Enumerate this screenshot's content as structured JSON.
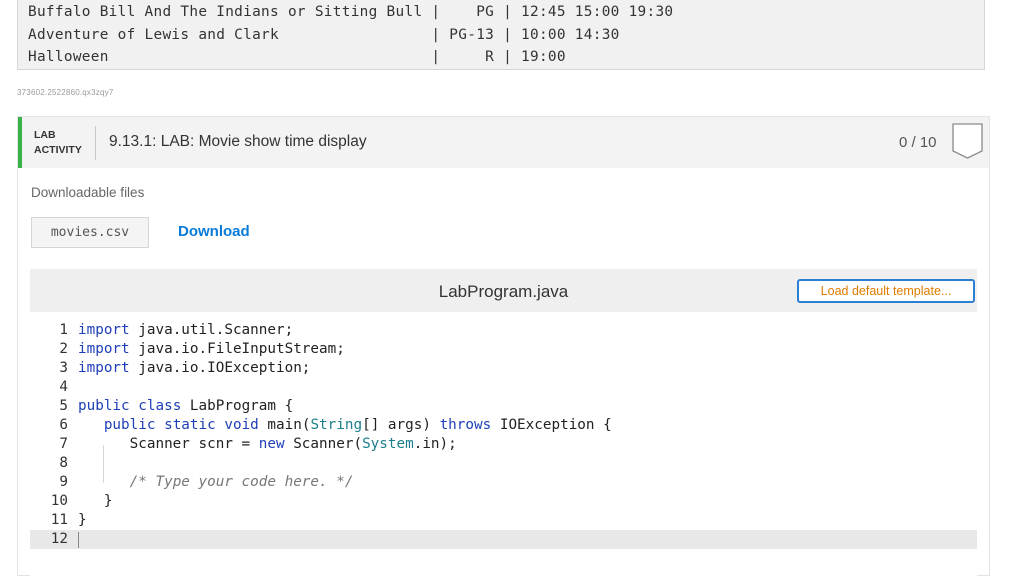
{
  "sample_output": {
    "lines": [
      "Buffalo Bill And The Indians or Sitting Bull |    PG | 12:45 15:00 19:30",
      "Adventure of Lewis and Clark                 | PG-13 | 10:00 14:30",
      "Halloween                                    |     R | 19:00"
    ]
  },
  "caption_id": "373602.2522860.qx3zqy7",
  "lab": {
    "tag_line1": "LAB",
    "tag_line2": "ACTIVITY",
    "title": "9.13.1: LAB: Movie show time display",
    "score": "0 / 10"
  },
  "downloads": {
    "label": "Downloadable files",
    "file_name": "movies.csv",
    "link_label": "Download"
  },
  "editor": {
    "filename": "LabProgram.java",
    "template_button": "Load default template...",
    "line_numbers": [
      "1",
      "2",
      "3",
      "4",
      "5",
      "6",
      "7",
      "8",
      "9",
      "10",
      "11",
      "12"
    ],
    "active_line": 12,
    "code_lines": [
      "import java.util.Scanner;",
      "import java.io.FileInputStream;",
      "import java.io.IOException;",
      "",
      "public class LabProgram {",
      "   public static void main(String[] args) throws IOException {",
      "      Scanner scnr = new Scanner(System.in);",
      "",
      "      /* Type your code here. */",
      "   }",
      "}",
      ""
    ]
  },
  "colors": {
    "accent_green": "#3bb14a",
    "link_blue": "#0a7bd8",
    "button_orange": "#e07b00",
    "keyword_blue": "#1f3fb8"
  }
}
